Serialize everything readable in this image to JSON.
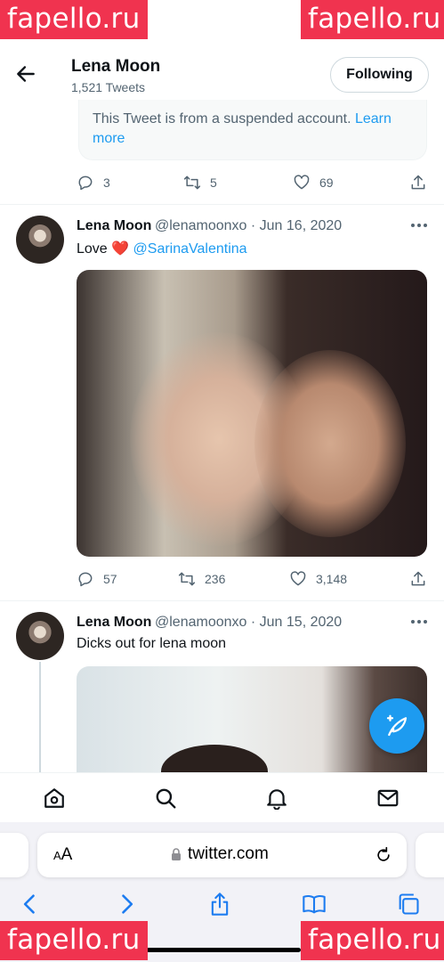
{
  "watermark": {
    "text": "fapello.ru"
  },
  "header": {
    "name": "Lena Moon",
    "tweet_count": "1,521 Tweets",
    "following_label": "Following"
  },
  "suspended_tweet": {
    "notice": "This Tweet is from a suspended account.",
    "link": "Learn more",
    "replies": "3",
    "retweets": "5",
    "likes": "69"
  },
  "tweets": [
    {
      "name": "Lena Moon",
      "handle": "@lenamoonxo",
      "sep": "·",
      "date": "Jun 16, 2020",
      "text": "Love",
      "emoji": "❤️",
      "mention": "@SarinaValentina",
      "replies": "57",
      "retweets": "236",
      "likes": "3,148"
    },
    {
      "name": "Lena Moon",
      "handle": "@lenamoonxo",
      "sep": "·",
      "date": "Jun 15, 2020",
      "text": "Dicks out for lena moon"
    }
  ],
  "browser": {
    "aa_small": "A",
    "aa_large": "A",
    "url": "twitter.com"
  },
  "colors": {
    "accent": "#1d9bf0",
    "watermark": "#f0334f",
    "secondary_text": "#536471"
  },
  "icons": [
    "back-arrow-icon",
    "reply-icon",
    "retweet-icon",
    "like-icon",
    "share-icon",
    "more-icon",
    "compose-tweet-icon",
    "home-icon",
    "search-icon",
    "notifications-icon",
    "messages-icon",
    "lock-icon",
    "reload-icon",
    "browser-back-icon",
    "browser-forward-icon",
    "browser-share-icon",
    "bookmarks-icon",
    "tabs-icon"
  ]
}
